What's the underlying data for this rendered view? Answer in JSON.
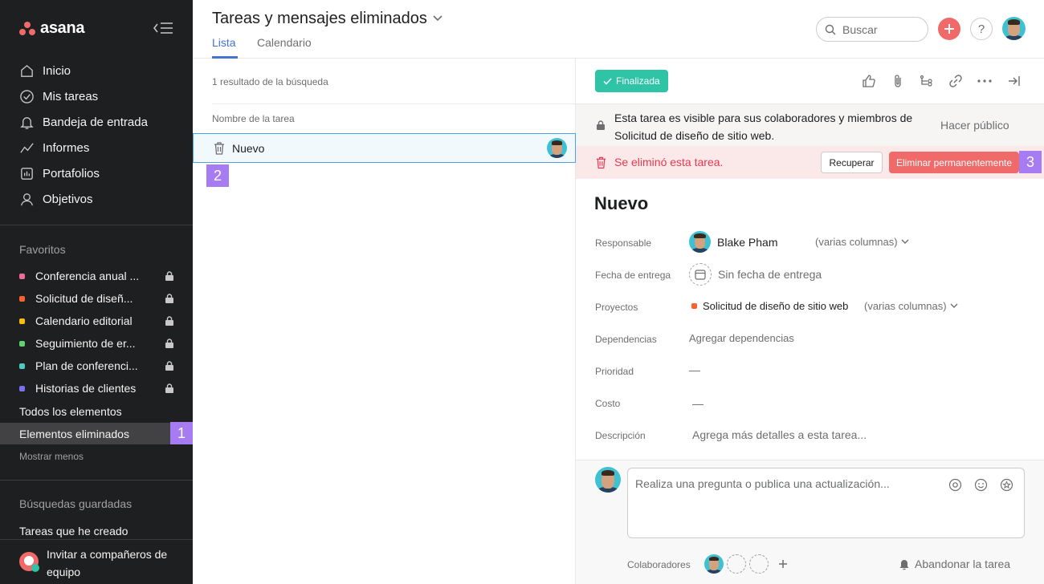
{
  "app": {
    "name": "asana"
  },
  "sidebar": {
    "nav": [
      {
        "label": "Inicio",
        "icon": "home-icon"
      },
      {
        "label": "Mis tareas",
        "icon": "check-circle-icon"
      },
      {
        "label": "Bandeja de entrada",
        "icon": "bell-icon"
      },
      {
        "label": "Informes",
        "icon": "chart-line-icon"
      },
      {
        "label": "Portafolios",
        "icon": "portfolio-icon"
      },
      {
        "label": "Objetivos",
        "icon": "person-icon"
      }
    ],
    "favorites_title": "Favoritos",
    "favorites": [
      {
        "label": "Conferencia anual ...",
        "color": "#f06a99"
      },
      {
        "label": "Solicitud de diseñ...",
        "color": "#fd612c"
      },
      {
        "label": "Calendario editorial",
        "color": "#fcbd01"
      },
      {
        "label": "Seguimiento de er...",
        "color": "#62d26f"
      },
      {
        "label": "Plan de conferenci...",
        "color": "#4ecbc4"
      },
      {
        "label": "Historias de clientes",
        "color": "#7a6ff0"
      }
    ],
    "all_items": "Todos los elementos",
    "deleted_items": "Elementos eliminados",
    "show_less": "Mostrar menos",
    "saved_searches_title": "Búsquedas guardadas",
    "saved_search_item": "Tareas que he creado",
    "invite_line1": "Invitar a compañeros de",
    "invite_line2": "equipo"
  },
  "badges": [
    "1",
    "2",
    "3"
  ],
  "header": {
    "title": "Tareas y mensajes eliminados",
    "tabs": [
      "Lista",
      "Calendario"
    ],
    "search_placeholder": "Buscar",
    "help": "?"
  },
  "list": {
    "results": "1 resultado de la búsqueda",
    "column_header": "Nombre de la tarea",
    "tasks": [
      {
        "name": "Nuevo"
      }
    ]
  },
  "detail": {
    "status": "Finalizada",
    "notice": "Esta tarea es visible para sus colaboradores y miembros de Solicitud de diseño de sitio web.",
    "make_public": "Hacer público",
    "deleted_notice": "Se eliminó esta tarea.",
    "recover": "Recuperar",
    "delete_permanently": "Eliminar permanentemente",
    "title": "Nuevo",
    "fields": {
      "assignee_label": "Responsable",
      "assignee_value": "Blake Pham",
      "assignee_columns": "(varias columnas)",
      "due_label": "Fecha de entrega",
      "due_value": "Sin fecha de entrega",
      "projects_label": "Proyectos",
      "project_value": "Solicitud de diseño de sitio web",
      "project_columns": "(varias columnas)",
      "project_color": "#fd612c",
      "dependencies_label": "Dependencias",
      "dependencies_value": "Agregar dependencias",
      "priority_label": "Prioridad",
      "priority_value": "—",
      "cost_label": "Costo",
      "cost_value": "—",
      "description_label": "Descripción",
      "description_placeholder": "Agrega más detalles a esta tarea..."
    },
    "comment_placeholder": "Realiza una pregunta o publica una actualización...",
    "collaborators_label": "Colaboradores",
    "leave_task": "Abandonar la tarea"
  }
}
